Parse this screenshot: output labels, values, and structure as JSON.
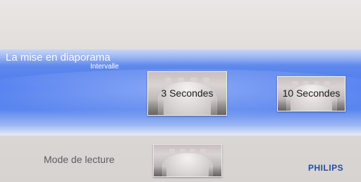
{
  "menu": {
    "title": "La mise en diaporama",
    "subtitle": "Intervalle",
    "options": [
      {
        "label": "3 Secondes",
        "selected": true
      },
      {
        "label": "10 Secondes",
        "selected": false
      }
    ]
  },
  "secondary": {
    "label": "Mode de lecture"
  },
  "brand": {
    "name": "PHILIPS",
    "color": "#1f4f9e"
  },
  "colors": {
    "band": "#4d7bf0",
    "background": "#dedad8"
  }
}
